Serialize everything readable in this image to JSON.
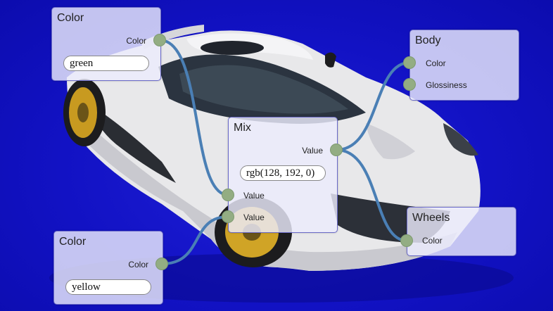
{
  "nodes": {
    "color_green": {
      "title": "Color",
      "output_label": "Color",
      "value": "green"
    },
    "color_yellow": {
      "title": "Color",
      "output_label": "Color",
      "value": "yellow"
    },
    "mix": {
      "title": "Mix",
      "output_label": "Value",
      "value": "rgb(128, 192, 0)",
      "input_a_label": "Value",
      "input_b_label": "Value"
    },
    "body": {
      "title": "Body",
      "input_color_label": "Color",
      "input_glossiness_label": "Glossiness"
    },
    "wheels": {
      "title": "Wheels",
      "input_color_label": "Color"
    }
  },
  "colors": {
    "background": "#1212c4",
    "node_fill": "#ececfc",
    "node_border": "#6a6ac8",
    "port": "#93ad83",
    "wire": "#4a7fb5"
  }
}
